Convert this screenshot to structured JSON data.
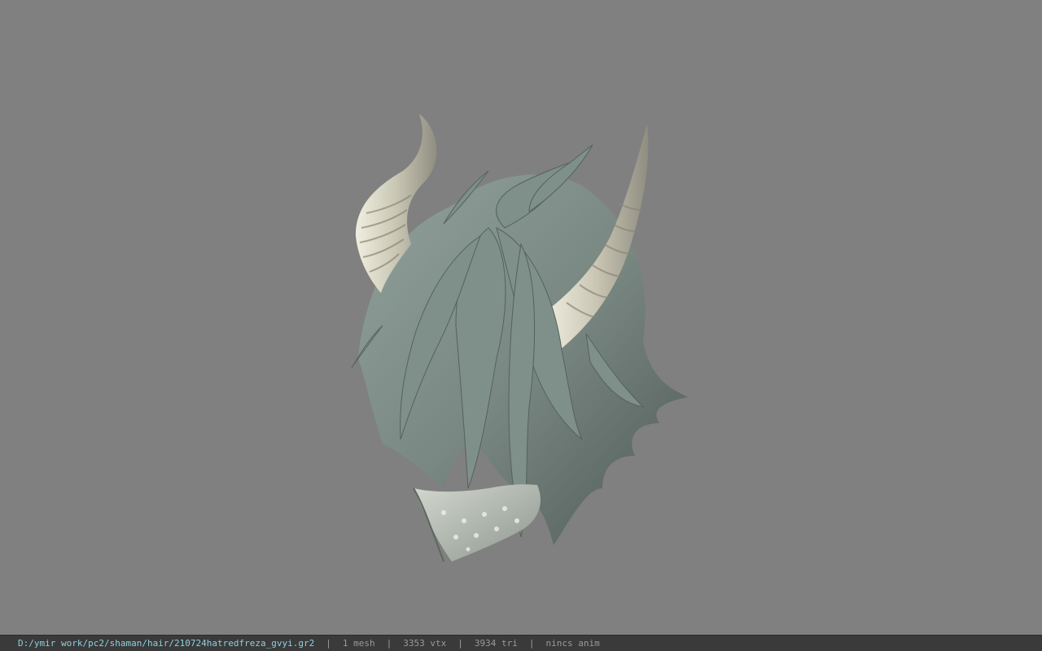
{
  "viewport": {
    "background_color": "#808080",
    "model": {
      "icon": "hair-model-with-horns",
      "hair_color": "#7c8a86",
      "horn_color": "#d6d4c4",
      "mask_color": "#a9b2aa"
    }
  },
  "status_bar": {
    "file_path": "D:/ymir work/pc2/shaman/hair/210724hatredfreza_gvyi.gr2",
    "separator": "|",
    "mesh_count": "1 mesh",
    "vertex_count": "3353 vtx",
    "triangle_count": "3934 tri",
    "animation_status": "nincs anim",
    "path_color": "#8fd0e0",
    "text_color": "#9a9a9a"
  }
}
